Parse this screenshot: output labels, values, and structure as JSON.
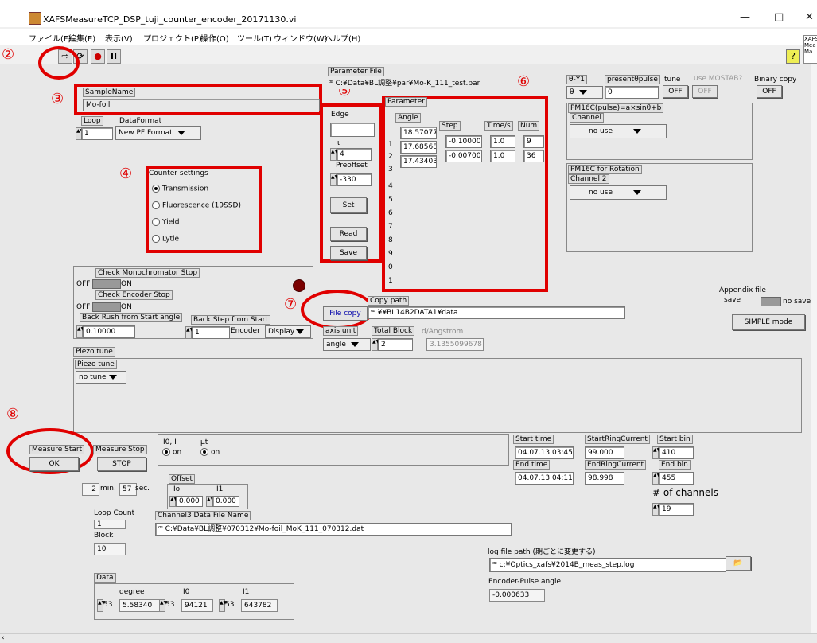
{
  "window": {
    "title": "XAFSMeasureTCP_DSP_tuji_counter_encoder_20171130.vi",
    "min": "—",
    "max": "□",
    "close": "✕"
  },
  "menu": [
    "ファイル(F)",
    "編集(E)",
    "表示(V)",
    "プロジェクト(P)",
    "操作(O)",
    "ツール(T)",
    "ウィンドウ(W)",
    "ヘルプ(H)"
  ],
  "annotations": {
    "a2": "②",
    "a3": "③",
    "a4": "④",
    "a5": "⑤",
    "a6": "⑥",
    "a7": "⑦",
    "a8": "⑧"
  },
  "sample": {
    "label": "SampleName",
    "value": "Mo-foil"
  },
  "loop": {
    "label": "Loop",
    "value": "1"
  },
  "dataformat": {
    "label": "DataFormat",
    "value": "New PF Format"
  },
  "counter": {
    "label": "Counter settings",
    "options": [
      "Transmission",
      "Fluorescence (19SSD)",
      "Yield",
      "Lytle"
    ],
    "selected": 0
  },
  "edge": {
    "label": "Edge",
    "value": "",
    "sub_label": "ι",
    "k_value": "4",
    "preoffset_label": "Preoffset",
    "preoffset_value": "-330",
    "set": "Set",
    "read": "Read",
    "save": "Save"
  },
  "param_file": {
    "label": "Parameter File",
    "value": "C:¥Data¥BL調整¥par¥Mo-K_111_test.par"
  },
  "parameter": {
    "label": "Parameter",
    "angle_label": "Angle",
    "step_label": "Step",
    "time_label": "Time/s",
    "num_label": "Num",
    "angles": [
      "18.57077",
      "17.68568",
      "17.43403"
    ],
    "steps": [
      "-0.10000",
      "-0.00700"
    ],
    "times": [
      "1.0",
      "1.0"
    ],
    "nums": [
      "9",
      "36"
    ],
    "rows": [
      "1",
      "2",
      "3",
      "4",
      "5",
      "6",
      "7",
      "8",
      "9",
      "0",
      "1"
    ]
  },
  "theta": {
    "label": "θ-Y1",
    "value": "θ",
    "present_label": "presentθpulse",
    "present_value": "0",
    "tune_label": "tune",
    "tune_value": "OFF",
    "mostab_label": "use MOSTAB?",
    "mostab_value": "OFF",
    "binary_label": "Binary copy",
    "binary_value": "OFF"
  },
  "pm16c": {
    "label": "PM16C(pulse)=a×sinθ+b",
    "channel_label": "Channel",
    "channel_value": "no use",
    "rot_label": "PM16C for Rotation",
    "ch2_label": "Channel 2",
    "ch2_value": "no use"
  },
  "mono": {
    "label": "Check Monochromator Stop",
    "off": "OFF",
    "on": "ON",
    "enc_label": "Check Encoder Stop",
    "enc_off": "OFF",
    "enc_on": "ON"
  },
  "backrush": {
    "label": "Back Rush from Start angle",
    "value": "0.10000",
    "step_label": "Back Step from Start",
    "step_value": "1",
    "encoder": "Encoder",
    "display": "Display"
  },
  "filecopy": {
    "button": "File copy",
    "path_label": "Copy path",
    "path_value": "¥¥BL14B2DATA1¥data"
  },
  "axis": {
    "label": "axis unit",
    "value": "angle",
    "total_label": "Total Block",
    "total_value": "2",
    "d_label": "d/Angstrom",
    "d_value": "3.1355099678"
  },
  "appendix": {
    "label": "Appendix file",
    "sub": "save",
    "nosave": "no save",
    "simple": "SIMPLE mode"
  },
  "piezo": {
    "label": "Piezo tune",
    "inner_label": "Piezo tune",
    "value": "no tune"
  },
  "measure": {
    "start_label": "Measure Start",
    "start_btn": "OK",
    "stop_label": "Measure Stop",
    "stop_btn": "STOP"
  },
  "time": {
    "min_value": "2",
    "min_label": "min.",
    "sec_value": "57",
    "sec_label": "sec."
  },
  "io": {
    "i0_label": "I0, I",
    "i0_value": "on",
    "mut_label": "μt",
    "mut_value": "on"
  },
  "offset": {
    "label": "Offset",
    "io_label": "Io",
    "i1_label": "I1",
    "io_value": "0.000",
    "i1_value": "0.000"
  },
  "times": {
    "start_label": "Start time",
    "start_value": "04.07.13 03:45",
    "end_label": "End time",
    "end_value": "04.07.13 04:11",
    "src_label": "StartRingCurrent",
    "src_value": "99.000",
    "erc_label": "EndRingCurrent",
    "erc_value": "98.998",
    "sbin_label": "Start bin",
    "sbin_value": "410",
    "ebin_label": "End bin",
    "ebin_value": "455",
    "ch_label": "# of channels",
    "ch_value": "19"
  },
  "loopcount": {
    "label": "Loop Count",
    "value": "1",
    "block_label": "Block",
    "block_value": "10"
  },
  "ch3": {
    "label": "Channel3 Data File Name",
    "value": "C:¥Data¥BL調整¥070312¥Mo-foil_MoK_111_070312.dat"
  },
  "log": {
    "label": "log file path (期ごとに変更する)",
    "value": "c:¥Optics_xafs¥2014B_meas_step.log"
  },
  "encoder": {
    "label": "Encoder-Pulse angle",
    "value": "-0.000633"
  },
  "data": {
    "label": "Data",
    "degree_label": "degree",
    "i0_label": "I0",
    "i1_label": "I1",
    "n1": "53",
    "degree_value": "5.58340",
    "n2": "53",
    "i0_value": "94121",
    "n3": "53",
    "i1_value": "643782"
  },
  "side_label": "XAFS Mea Ma"
}
